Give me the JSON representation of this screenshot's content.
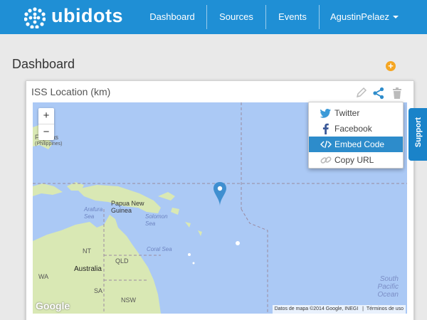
{
  "nav": {
    "logo_text": "ubidots",
    "items": [
      {
        "label": "Dashboard"
      },
      {
        "label": "Sources"
      },
      {
        "label": "Events"
      }
    ],
    "user": "AgustinPelaez"
  },
  "page": {
    "title": "Dashboard",
    "add_icon": "plus-circle-icon",
    "add_label": "+"
  },
  "widget": {
    "title": "ISS Location (km)",
    "actions": [
      "pencil-icon",
      "share-icon",
      "trash-icon"
    ]
  },
  "share_menu": {
    "items": [
      {
        "label": "Twitter",
        "icon": "twitter-icon"
      },
      {
        "label": "Facebook",
        "icon": "facebook-icon"
      },
      {
        "label": "Embed Code",
        "icon": "code-icon"
      },
      {
        "label": "Copy URL",
        "icon": "link-icon"
      }
    ],
    "active_index": 2
  },
  "map": {
    "zoom_in": "+",
    "zoom_out": "−",
    "labels": {
      "filipinas": "Filipinas",
      "philippines": "(Philippines)",
      "papua": "Papua New\nGuinea",
      "arafura": "Arafura\nSea",
      "solomon": "Solomon\nSea",
      "coral": "Coral Sea",
      "australia": "Australia",
      "nt": "NT",
      "qld": "QLD",
      "wa": "WA",
      "sa": "SA",
      "nsw": "NSW",
      "south_pacific": "South\nPacific\nOcean"
    },
    "attribution": "Datos de mapa ©2014 Google, INEGI",
    "terms": "Términos de uso",
    "google": "Google"
  },
  "support": {
    "label": "Support"
  },
  "colors": {
    "navbar": "#1f8fd5",
    "accent": "#2d8ccb",
    "add_button": "#f5a623",
    "land": "#d9e8b4",
    "water": "#abc9f5"
  }
}
